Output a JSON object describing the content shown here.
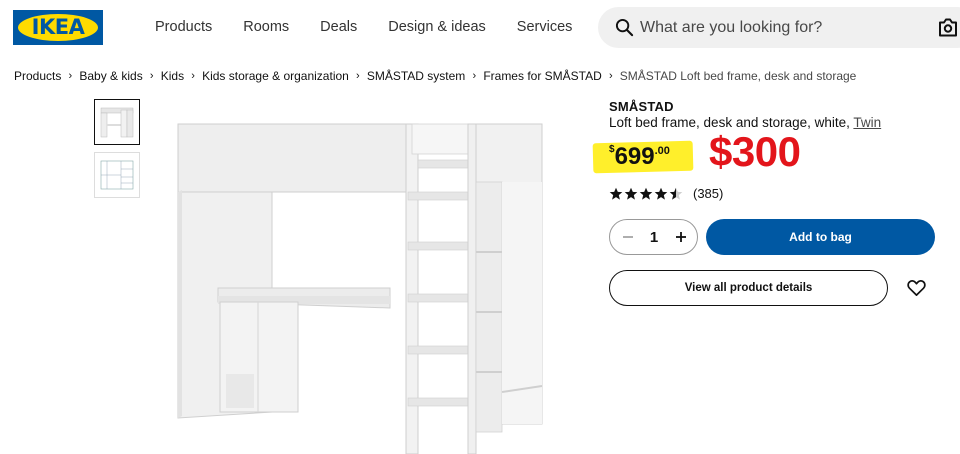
{
  "brand": {
    "logo_text": "IKEA",
    "blue": "#0058a3",
    "yellow": "#ffdb00"
  },
  "nav": {
    "items": [
      "Products",
      "Rooms",
      "Deals",
      "Design & ideas",
      "Services"
    ]
  },
  "search": {
    "placeholder": "What are you looking for?",
    "icon": "search-icon",
    "camera_icon": "camera-icon"
  },
  "breadcrumb": {
    "items": [
      "Products",
      "Baby & kids",
      "Kids",
      "Kids storage & organization",
      "SMÅSTAD system",
      "Frames for SMÅSTAD"
    ],
    "current": "SMÅSTAD Loft bed frame, desk and storage"
  },
  "product": {
    "name": "SMÅSTAD",
    "description": "Loft bed frame, desk and storage, white,",
    "size_link": "Twin",
    "old_price": {
      "currency": "$",
      "integer": "699",
      "decimals": ".00"
    },
    "new_price": "$300",
    "rating": {
      "stars": 4.5,
      "max": 5,
      "count_text": "(385)"
    },
    "quantity": "1",
    "add_button": "Add to bag",
    "details_button": "View all product details",
    "colors": {
      "sale_red": "#e3151b",
      "highlight_yellow": "#ffef2b"
    }
  }
}
